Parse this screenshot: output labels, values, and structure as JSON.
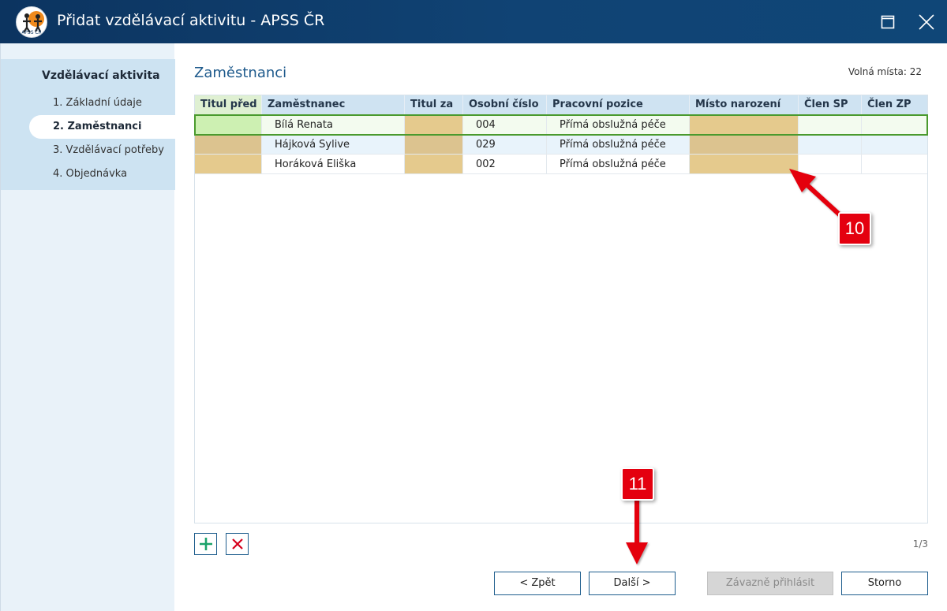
{
  "window": {
    "title": "Přidat vzdělávací aktivitu - APSS ČR",
    "logo_text": "APSS ČR"
  },
  "sidebar": {
    "heading": "Vzdělávací aktivita",
    "items": [
      {
        "label": "1. Základní údaje",
        "active": false
      },
      {
        "label": "2. Zaměstnanci",
        "active": true
      },
      {
        "label": "3. Vzdělávací potřeby",
        "active": false
      },
      {
        "label": "4. Objednávka",
        "active": false
      }
    ]
  },
  "main": {
    "title": "Zaměstnanci",
    "free_seats": "Volná místa: 22"
  },
  "table": {
    "columns": [
      "Titul před",
      "Zaměstnanec",
      "Titul za",
      "Osobní číslo",
      "Pracovní pozice",
      "Místo narození",
      "Člen SP",
      "Člen ZP"
    ],
    "rows": [
      {
        "titul_pred": "",
        "zamestnanec": "Bílá Renata",
        "titul_za": "",
        "osobni_cislo": "004",
        "pozice": "Přímá obslužná péče",
        "misto": "",
        "clen_sp": "",
        "clen_zp": ""
      },
      {
        "titul_pred": "",
        "zamestnanec": "Hájková Sylive",
        "titul_za": "",
        "osobni_cislo": "029",
        "pozice": "Přímá obslužná péče",
        "misto": "",
        "clen_sp": "",
        "clen_zp": ""
      },
      {
        "titul_pred": "",
        "zamestnanec": "Horáková Eliška",
        "titul_za": "",
        "osobni_cislo": "002",
        "pozice": "Přímá obslužná péče",
        "misto": "",
        "clen_sp": "",
        "clen_zp": ""
      }
    ],
    "pager": "1/3"
  },
  "buttons": {
    "back": "< Zpět",
    "next": "Další >",
    "submit": "Závazně přihlásit",
    "cancel": "Storno"
  },
  "callouts": {
    "c1": "10",
    "c2": "11"
  },
  "colors": {
    "titlebar": "#0c3460",
    "accent": "#1e5a8c",
    "required_cell": "#e5ca8d",
    "selected_outline": "#4a9a2e",
    "callout": "#e4000f",
    "add_icon": "#1aa36a",
    "remove_icon": "#d6001c"
  },
  "icons": {
    "logo": "apss-logo",
    "maximize": "maximize-icon",
    "close": "close-icon",
    "add": "plus-icon",
    "remove": "x-icon"
  }
}
